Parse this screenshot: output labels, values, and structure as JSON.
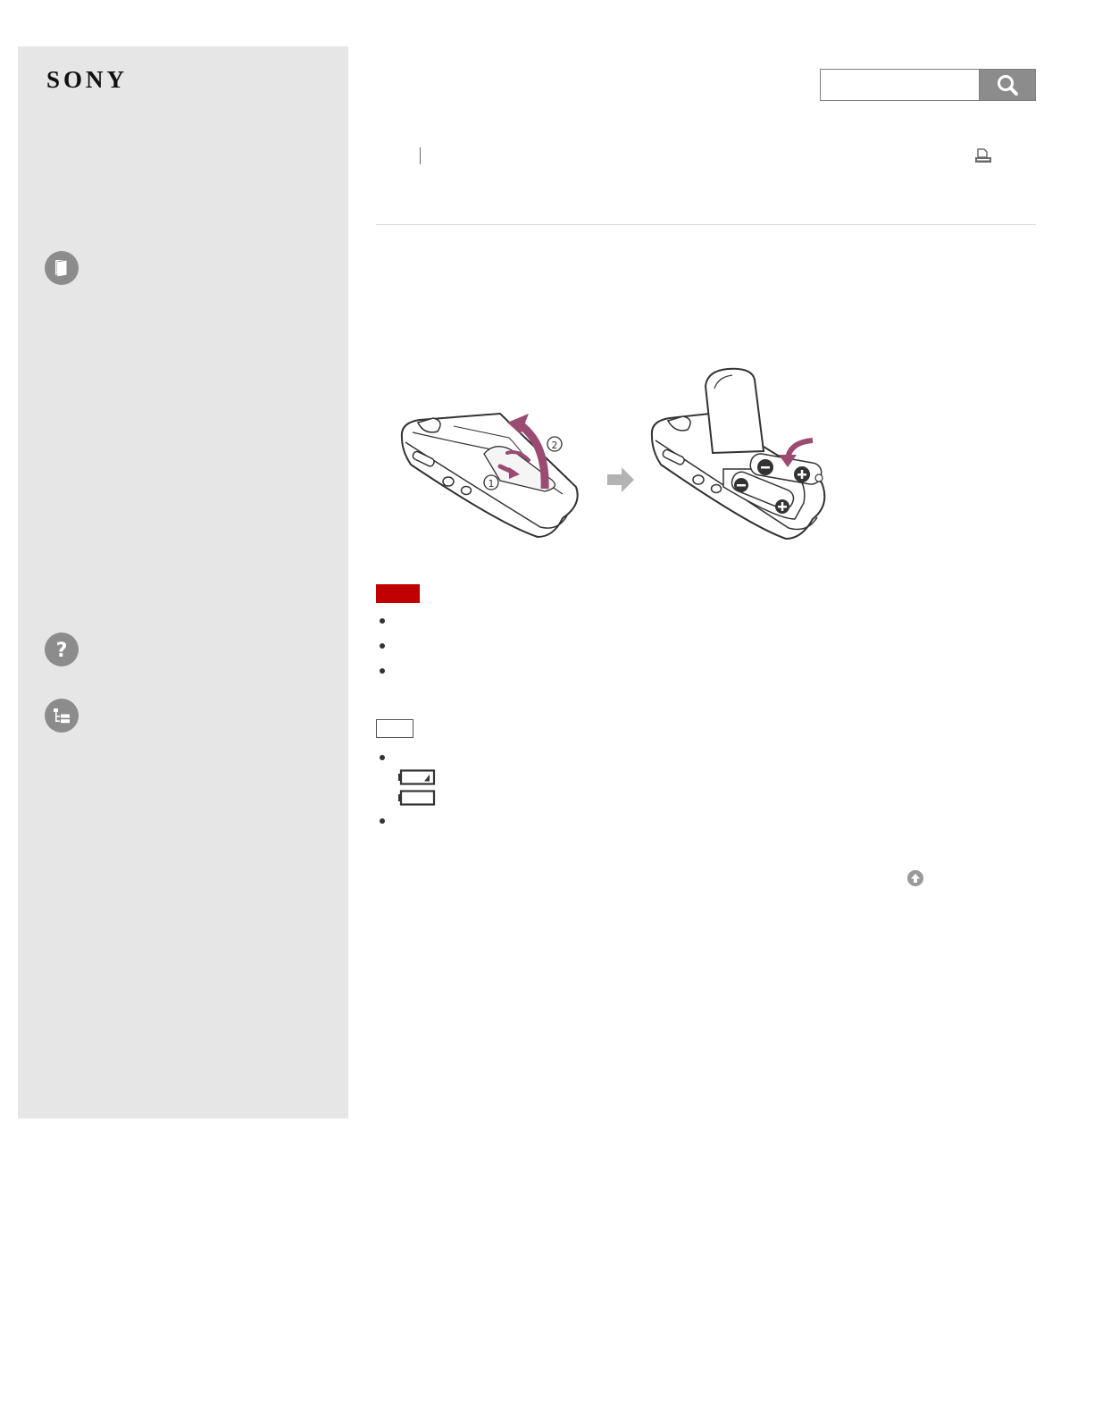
{
  "brand": {
    "logo_text": "SONY"
  },
  "search": {
    "placeholder": "",
    "value": "",
    "button_icon": "search-icon"
  },
  "toolbar": {
    "print_icon": "print-icon"
  },
  "sidebar": {
    "icons": [
      "book-icon",
      "help-icon",
      "contents-tree-icon"
    ]
  },
  "illustration": {
    "step_markers": [
      "①",
      "②"
    ],
    "arrow_color": "#9b4a72"
  },
  "labels": {
    "note_color": "#c00000",
    "hint_border_color": "#555555"
  },
  "battery_indicators": [
    {
      "icon": "battery-low-icon",
      "level": 0.2
    },
    {
      "icon": "battery-empty-icon",
      "level": 0
    }
  ],
  "footer": {
    "back_to_top_icon": "arrow-up-icon"
  }
}
